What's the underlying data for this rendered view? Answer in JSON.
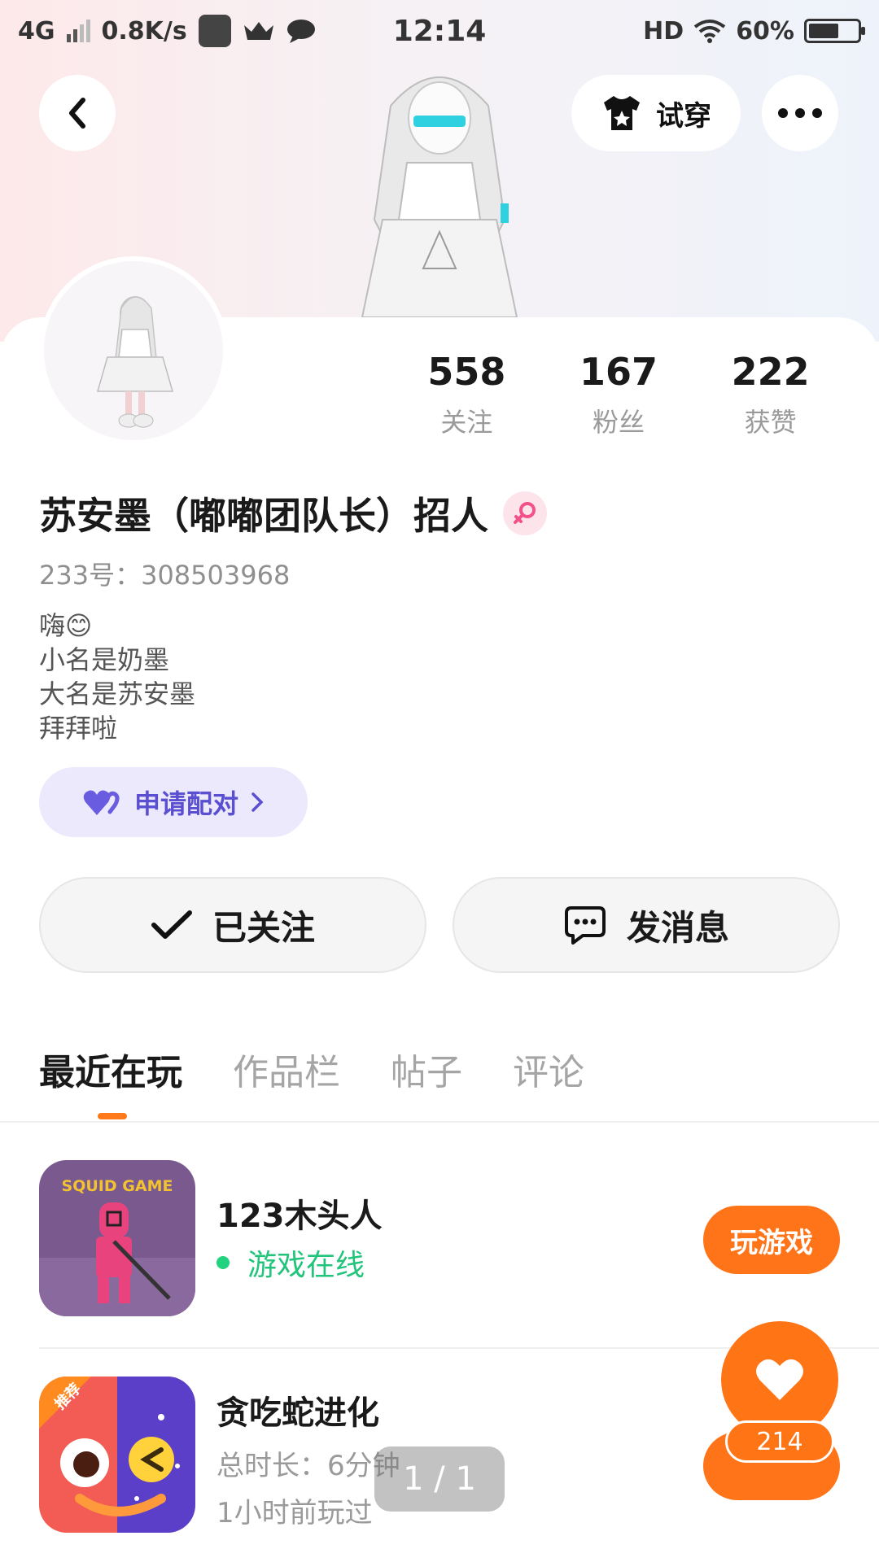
{
  "status_bar": {
    "network": "4G",
    "speed": "0.8K/s",
    "time": "12:14",
    "hd": "HD",
    "battery": "60%",
    "battery_level": 0.6
  },
  "header": {
    "tryon_label": "试穿"
  },
  "stats": [
    {
      "value": "558",
      "label": "关注"
    },
    {
      "value": "167",
      "label": "粉丝"
    },
    {
      "value": "222",
      "label": "获赞"
    }
  ],
  "profile": {
    "name": "苏安墨（嘟嘟团队长）招人",
    "uid": "233号：308503968",
    "bio_lines": [
      "嗨😊",
      "小名是奶墨",
      "大名是苏安墨",
      "拜拜啦"
    ],
    "pair_label": "申请配对"
  },
  "actions": {
    "follow_label": "已关注",
    "message_label": "发消息"
  },
  "tabs": [
    "最近在玩",
    "作品栏",
    "帖子",
    "评论"
  ],
  "games": [
    {
      "title": "123木头人",
      "status": "游戏在线",
      "button": "玩游戏",
      "icon_text": "SQUID GAME"
    },
    {
      "title": "贪吃蛇进化",
      "duration": "总时长：6分钟",
      "last_played": "1小时前玩过",
      "badge": "推荐"
    }
  ],
  "likes": "214",
  "pager": "1 / 1"
}
